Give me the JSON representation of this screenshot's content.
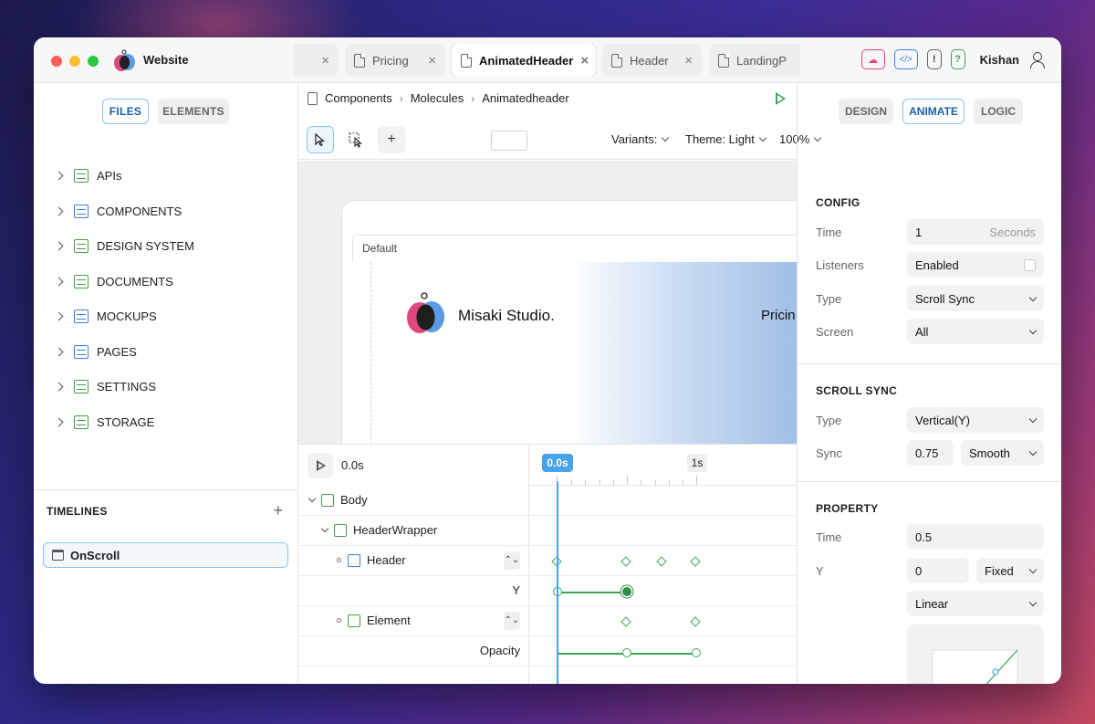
{
  "app": {
    "title": "Website",
    "user": "Kishan"
  },
  "tabs": [
    {
      "label": "",
      "state": "clipped"
    },
    {
      "label": "Pricing"
    },
    {
      "label": "AnimatedHeader",
      "active": true
    },
    {
      "label": "Header"
    },
    {
      "label": "LandingP"
    }
  ],
  "top_icons": [
    "cloud-icon",
    "code-icon",
    "warning-icon",
    "help-icon",
    "user-icon"
  ],
  "left_panel": {
    "segments": [
      "FILES",
      "ELEMENTS"
    ],
    "tree": [
      {
        "label": "APIs",
        "icon": "table-icon"
      },
      {
        "label": "COMPONENTS",
        "icon": "layout-icon"
      },
      {
        "label": "DESIGN SYSTEM",
        "icon": "grid-icon"
      },
      {
        "label": "DOCUMENTS",
        "icon": "document-icon"
      },
      {
        "label": "MOCKUPS",
        "icon": "mockup-icon"
      },
      {
        "label": "PAGES",
        "icon": "page-icon"
      },
      {
        "label": "SETTINGS",
        "icon": "settings-icon"
      },
      {
        "label": "STORAGE",
        "icon": "storage-icon"
      }
    ],
    "timelines_title": "TIMELINES",
    "timeline_item": "OnScroll"
  },
  "center": {
    "breadcrumb": [
      "Components",
      "Molecules",
      "Animatedheader"
    ],
    "toolbar": {
      "variants": "Variants:",
      "theme": "Theme: Light",
      "zoom": "100%"
    },
    "canvas": {
      "frame_label": "Default",
      "brand": "Misaki Studio.",
      "nav_item": "Pricin"
    },
    "timeline": {
      "time": "0.0s",
      "playhead": "0.0s",
      "second_marker": "1s",
      "rows": [
        {
          "label": "Body"
        },
        {
          "label": "HeaderWrapper"
        },
        {
          "label": "Header"
        },
        {
          "label": "Y"
        },
        {
          "label": "Element"
        },
        {
          "label": "Opacity"
        }
      ]
    }
  },
  "right_panel": {
    "segments": [
      "DESIGN",
      "ANIMATE",
      "LOGIC"
    ],
    "config": {
      "title": "CONFIG",
      "time_label": "Time",
      "time_value": "1",
      "time_unit": "Seconds",
      "listeners_label": "Listeners",
      "listeners_value": "Enabled",
      "type_label": "Type",
      "type_value": "Scroll Sync",
      "screen_label": "Screen",
      "screen_value": "All"
    },
    "scroll_sync": {
      "title": "SCROLL SYNC",
      "type_label": "Type",
      "type_value": "Vertical(Y)",
      "sync_label": "Sync",
      "sync_value": "0.75",
      "sync_mode": "Smooth"
    },
    "property": {
      "title": "PROPERTY",
      "time_label": "Time",
      "time_value": "0.5",
      "y_label": "Y",
      "y_value": "0",
      "y_mode": "Fixed",
      "easing": "Linear"
    }
  },
  "colors": {
    "accent_blue": "#4aa3ea",
    "keyframe_green": "#3aa757",
    "brand_pink": "#e0477e"
  }
}
